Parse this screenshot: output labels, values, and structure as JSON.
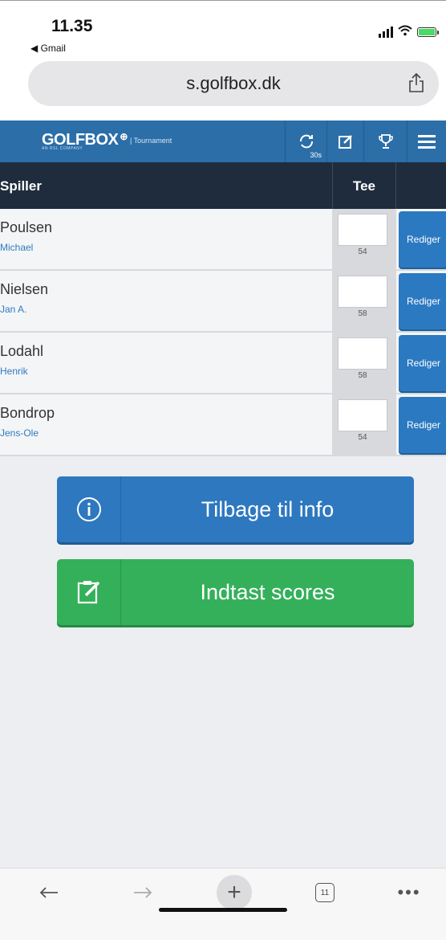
{
  "status_bar": {
    "time": "11.35",
    "back_app": "◀ Gmail"
  },
  "browser": {
    "url": "s.golfbox.dk"
  },
  "header": {
    "logo": "GOLFBOX",
    "logo_sub": "AN RSL COMPANY",
    "tagline": "| Tournament",
    "refresh_interval": "30s"
  },
  "table": {
    "columns": [
      "Spiller",
      "Tee"
    ],
    "edit_label": "Rediger",
    "rows": [
      {
        "surname": "Poulsen",
        "firstname": "Michael",
        "hcp": "54"
      },
      {
        "surname": "Nielsen",
        "firstname": "Jan A.",
        "hcp": "58"
      },
      {
        "surname": "Lodahl",
        "firstname": "Henrik",
        "hcp": "58"
      },
      {
        "surname": "Bondrop",
        "firstname": "Jens-Ole",
        "hcp": "54"
      }
    ]
  },
  "actions": {
    "info_label": "Tilbage til info",
    "scores_label": "Indtast scores"
  },
  "toolbar": {
    "tab_count": "11"
  },
  "colors": {
    "brand_blue": "#2b6ea8",
    "table_header": "#1e2c3d",
    "edit_blue": "#2b79c1",
    "green": "#34b05a"
  }
}
